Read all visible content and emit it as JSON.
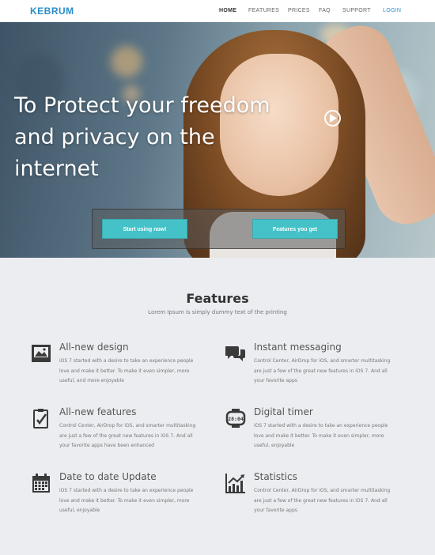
{
  "brand": "KEBRUM",
  "nav": {
    "items": [
      {
        "label": "HOME",
        "active": true
      },
      {
        "label": "FEATURES"
      },
      {
        "label": "PRICES"
      },
      {
        "label": "FAQ"
      },
      {
        "label": "SUPPORT"
      }
    ],
    "login": "LOGIN"
  },
  "hero": {
    "title_line1": "To Protect your freedom",
    "title_line2": "and privacy on the internet",
    "start_button": "Start using now!",
    "features_button": "Features you get"
  },
  "features": {
    "title": "Features",
    "subtitle": "Lorem Ipsum is simply dummy text of the printing",
    "items": [
      {
        "icon": "image-icon",
        "title": "All-new design",
        "desc": "iOS 7 started with a desire to take an experience people love and make it better. To make it even simpler, more useful, and more enjoyable"
      },
      {
        "icon": "chat-icon",
        "title": "Instant messaging",
        "desc": "Control Center, AirDrop for iOS, and smarter multitasking are just a few of the great new features in iOS 7. And all your favorite apps"
      },
      {
        "icon": "clipboard-check-icon",
        "title": "All-new features",
        "desc": "Control Center, AirDrop for iOS, and smarter multitasking are just a few of the great new features in iOS 7. And all your favorite apps have been enhanced"
      },
      {
        "icon": "digital-watch-icon",
        "title": "Digital timer",
        "desc": "iOS 7 started with a desire to take an experience people love and make it better. To make it even simpler, more useful, enjoyable"
      },
      {
        "icon": "calendar-icon",
        "title": "Date to date Update",
        "desc": "iOS 7 started with a desire to take an experience people love and make it better. To make it even simpler, more useful, enjoyable"
      },
      {
        "icon": "bar-chart-icon",
        "title": "Statistics",
        "desc": "Control Center, AirDrop for iOS, and smarter multitasking are just a few of the great new features in iOS 7. And all your favorite apps"
      }
    ]
  },
  "colors": {
    "brand": "#2a8ec9",
    "button": "#45c2c8",
    "page_bg": "#ebedf0"
  }
}
